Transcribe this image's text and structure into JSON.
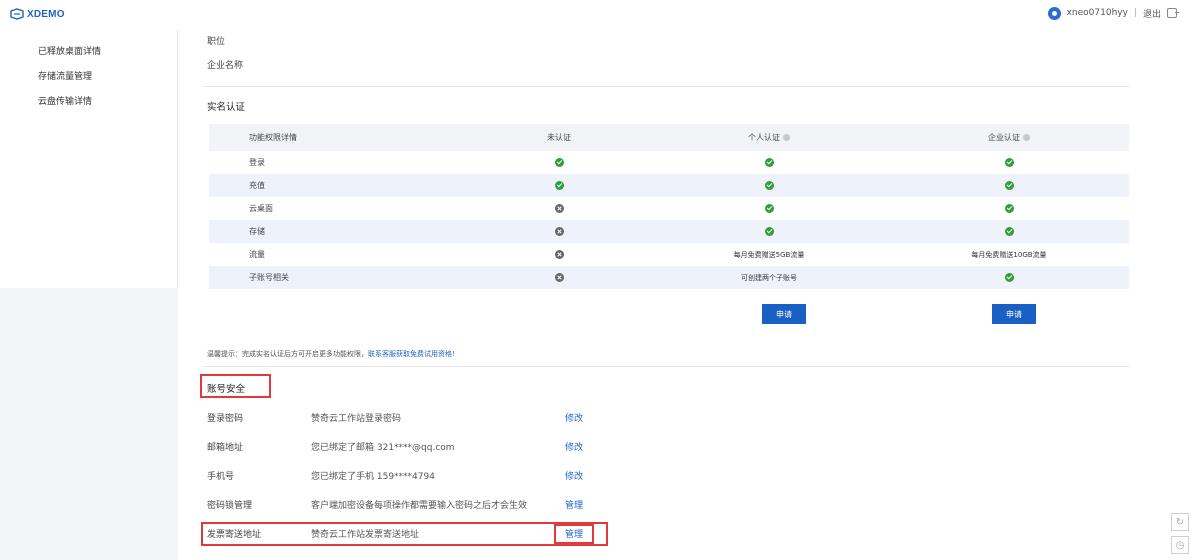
{
  "header": {
    "logo_text": "XDEMO",
    "username": "xneo0710hyy",
    "separator": "|",
    "logout_label": "退出"
  },
  "sidebar": {
    "items": [
      {
        "label": "已释放桌面详情"
      },
      {
        "label": "存储流量管理"
      },
      {
        "label": "云盘传输详情"
      }
    ]
  },
  "profile": {
    "position_label": "职位",
    "company_label": "企业名称"
  },
  "realname": {
    "title": "实名认证",
    "headers": [
      "功能权限详情",
      "未认证",
      "个人认证",
      "企业认证"
    ],
    "rows": [
      {
        "name": "登录",
        "unverified": "ok",
        "personal": "ok",
        "enterprise": "ok"
      },
      {
        "name": "充值",
        "unverified": "ok",
        "personal": "ok",
        "enterprise": "ok"
      },
      {
        "name": "云桌面",
        "unverified": "no",
        "personal": "ok",
        "enterprise": "ok"
      },
      {
        "name": "存储",
        "unverified": "no",
        "personal": "ok",
        "enterprise": "ok"
      },
      {
        "name": "流量",
        "unverified": "no",
        "personal": "每月免费赠送5GB流量",
        "enterprise": "每月免费赠送10GB流量"
      },
      {
        "name": "子账号相关",
        "unverified": "no",
        "personal": "可创建两个子账号",
        "enterprise": "ok"
      }
    ],
    "apply_personal": "申请",
    "apply_enterprise": "申请"
  },
  "tip": {
    "text": "温馨提示：完成实名认证后方可开启更多功能权限，",
    "link": "联系客服获取免费试用资格",
    "suffix": "!"
  },
  "security": {
    "title": "账号安全",
    "rows": [
      {
        "label": "登录密码",
        "value": "赞奇云工作站登录密码",
        "action": "修改"
      },
      {
        "label": "邮箱地址",
        "value": "您已绑定了邮箱 321****@qq.com",
        "action": "修改"
      },
      {
        "label": "手机号",
        "value": "您已绑定了手机 159****4794",
        "action": "修改"
      },
      {
        "label": "密码锁管理",
        "value": "客户端加密设备每项操作都需要输入密码之后才会生效",
        "action": "管理"
      },
      {
        "label": "发票寄送地址",
        "value": "赞奇云工作站发票寄送地址",
        "action": "管理"
      }
    ]
  },
  "colors": {
    "brand": "#1e63c7",
    "button": "#1a5fc4",
    "ok": "#2f9e3a",
    "highlight": "#e0393e"
  }
}
